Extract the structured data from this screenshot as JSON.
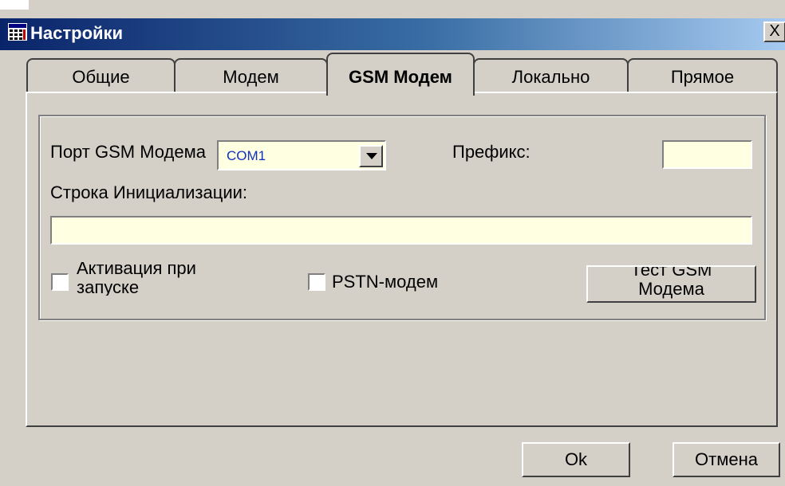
{
  "window": {
    "title": "Настройки",
    "close_label": "X"
  },
  "tabs": [
    {
      "label": "Общие",
      "active": false
    },
    {
      "label": "Модем",
      "active": false
    },
    {
      "label": "GSM Модем",
      "active": true
    },
    {
      "label": "Локально",
      "active": false
    },
    {
      "label": "Прямое",
      "active": false
    }
  ],
  "gsm": {
    "port_label": "Порт GSM Модема",
    "port_value": "COM1",
    "prefix_label": "Префикс:",
    "prefix_value": "",
    "init_label": "Строка Инициализации:",
    "init_value": "",
    "activate_label": "Активация при запуске",
    "activate_checked": false,
    "pstn_label": "PSTN-модем",
    "pstn_checked": false,
    "test_button": "Тест GSM Модема"
  },
  "footer": {
    "ok_label": "Ok",
    "cancel_label": "Отмена"
  },
  "colors": {
    "title_start": "#0a246a",
    "title_end": "#a6caf0",
    "face": "#d4d0c8",
    "field": "#ffffe1"
  }
}
